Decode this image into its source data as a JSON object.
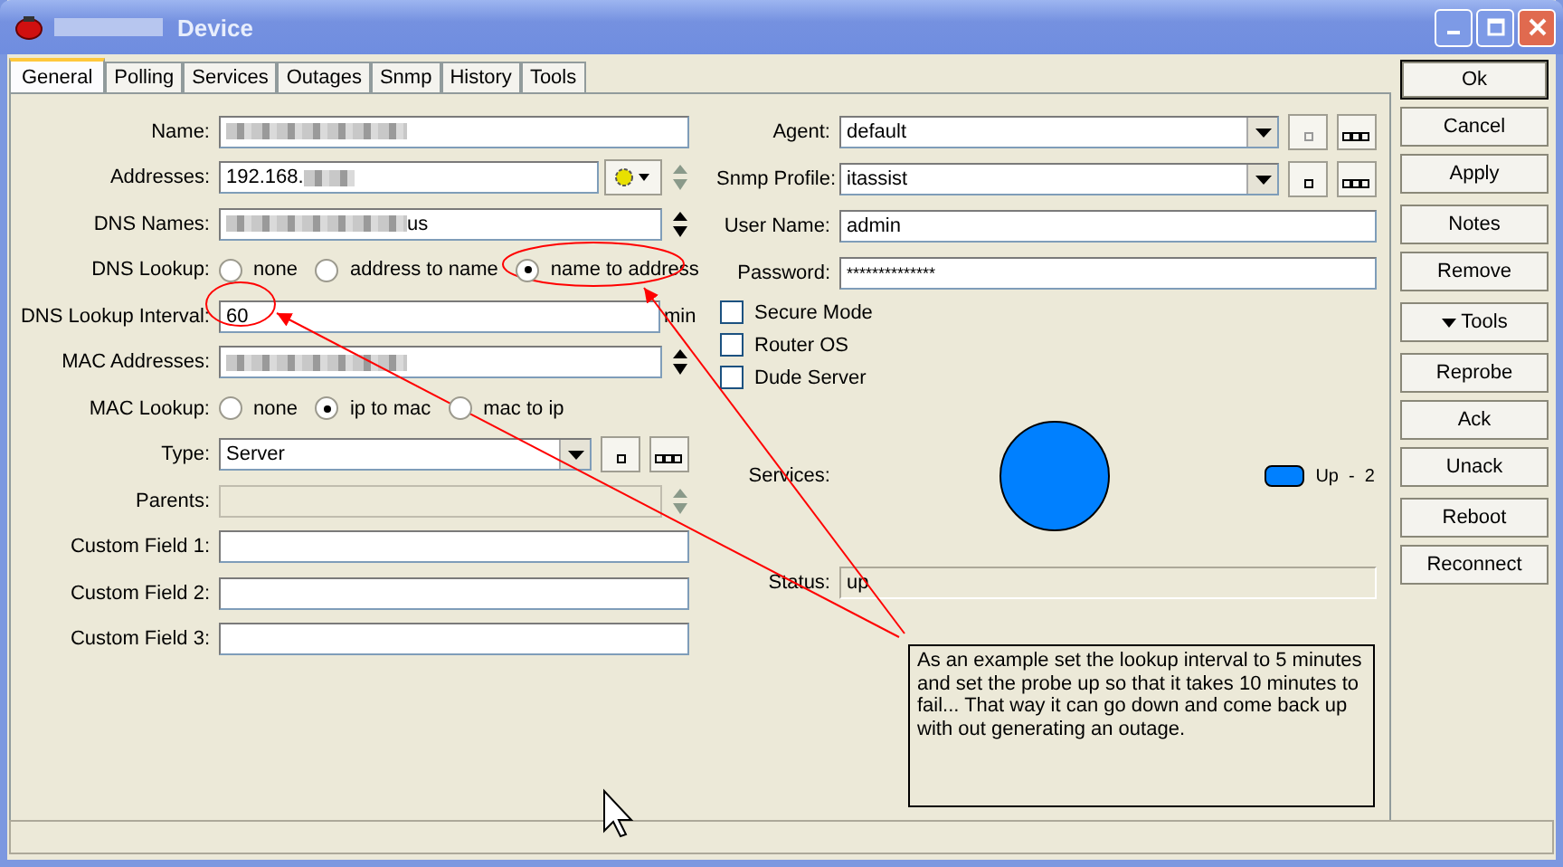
{
  "window": {
    "title": "Device"
  },
  "tabs": [
    {
      "label": "General",
      "selected": true
    },
    {
      "label": "Polling",
      "selected": false
    },
    {
      "label": "Services",
      "selected": false
    },
    {
      "label": "Outages",
      "selected": false
    },
    {
      "label": "Snmp",
      "selected": false
    },
    {
      "label": "History",
      "selected": false
    },
    {
      "label": "Tools",
      "selected": false
    }
  ],
  "left_fields": [
    {
      "kind": "text",
      "label": "Name:",
      "redacted_before": true
    },
    {
      "kind": "text",
      "label": "Addresses:",
      "value": "192.168.",
      "redacted_after": true,
      "gear_menu": true,
      "spin": {
        "enabled": false
      }
    },
    {
      "kind": "text",
      "label": "DNS Names:",
      "value": "us",
      "redacted_before": true,
      "spin": {
        "enabled": true
      }
    },
    {
      "kind": "radio",
      "label": "DNS Lookup:",
      "options": [
        {
          "label": "none",
          "selected": false
        },
        {
          "label": "address to name",
          "selected": false
        },
        {
          "label": "name to address",
          "selected": true
        }
      ]
    },
    {
      "kind": "text",
      "label": "DNS Lookup Interval:",
      "value": "60",
      "unit": "min"
    },
    {
      "kind": "text",
      "label": "MAC Addresses:",
      "redacted_before": true,
      "spin": {
        "enabled": true
      }
    },
    {
      "kind": "radio",
      "label": "MAC Lookup:",
      "options": [
        {
          "label": "none",
          "selected": false
        },
        {
          "label": "ip to mac",
          "selected": true
        },
        {
          "label": "mac to ip",
          "selected": false
        }
      ]
    },
    {
      "kind": "select",
      "label": "Type:",
      "value": "Server",
      "browse": {
        "add_enabled": true
      }
    },
    {
      "kind": "text",
      "label": "Parents:",
      "disabled": true,
      "spin": {
        "enabled": false
      }
    },
    {
      "kind": "text",
      "label": "Custom Field 1:"
    },
    {
      "kind": "text",
      "label": "Custom Field 2:"
    },
    {
      "kind": "text",
      "label": "Custom Field 3:"
    }
  ],
  "right_fields": [
    {
      "kind": "select",
      "label": "Agent:",
      "value": "default",
      "browse": {
        "add_enabled": false
      }
    },
    {
      "kind": "select",
      "label": "Snmp Profile:",
      "value": "itassist",
      "browse": {
        "add_enabled": true
      }
    },
    {
      "kind": "text",
      "label": "User Name:",
      "value": "admin"
    },
    {
      "kind": "password",
      "label": "Password:",
      "value": "**************"
    }
  ],
  "checkboxes": [
    {
      "label": "Secure Mode",
      "checked": false
    },
    {
      "label": "Router OS",
      "checked": false
    },
    {
      "label": "Dude Server",
      "checked": false
    }
  ],
  "services": {
    "label": "Services:",
    "legend": [
      {
        "label": "Up  -  2",
        "color": "#0080ff"
      }
    ],
    "chart_data": {
      "type": "pie",
      "values": [
        100
      ]
    }
  },
  "status": {
    "label": "Status:",
    "value": "up"
  },
  "button_groups": [
    [
      {
        "label": "Ok",
        "default": true
      },
      {
        "label": "Cancel",
        "default": false
      },
      {
        "label": "Apply",
        "default": false
      }
    ],
    [
      {
        "label": "Notes",
        "default": false
      },
      {
        "label": "Remove",
        "default": false
      }
    ],
    [
      {
        "label": "Tools",
        "default": false,
        "menu": true
      }
    ],
    [
      {
        "label": "Reprobe",
        "default": false
      },
      {
        "label": "Ack",
        "default": false
      },
      {
        "label": "Unack",
        "default": false
      }
    ],
    [
      {
        "label": "Reboot",
        "default": false
      },
      {
        "label": "Reconnect",
        "default": false
      }
    ]
  ],
  "annotation": {
    "note": "As an example set the lookup interval to 5 minutes and set the probe up so that it takes 10 minutes to fail... That way it can go down and come back up with out generating an outage."
  }
}
